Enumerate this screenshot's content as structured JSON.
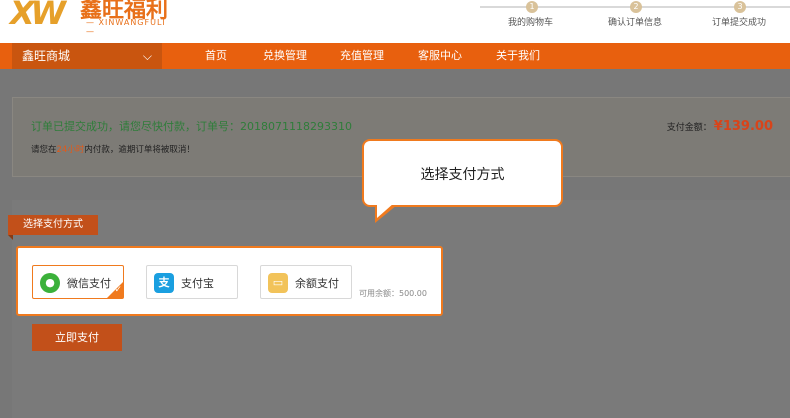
{
  "logo": {
    "mark": "XW",
    "name_cn": "鑫旺福利",
    "name_en": "— XINWANGFULI —"
  },
  "steps": [
    {
      "num": "1",
      "label": "我的购物车"
    },
    {
      "num": "2",
      "label": "确认订单信息"
    },
    {
      "num": "3",
      "label": "订单提交成功"
    }
  ],
  "nav": {
    "dropdown_label": "鑫旺商城",
    "items": [
      "首页",
      "兑换管理",
      "充值管理",
      "客服中心",
      "关于我们"
    ]
  },
  "order": {
    "status": "订单已提交成功，请您尽快付款，订单号：2018071118293310",
    "notice_prefix": "请您在",
    "notice_highlight": "24小时",
    "notice_suffix": "内付款，逾期订单将被取消！",
    "amount_label": "支付金额：",
    "amount_value": "¥139.00"
  },
  "payment": {
    "tab_label": "选择支付方式",
    "methods": [
      {
        "icon": "wechat-icon",
        "label": "微信支付",
        "color": "#3bb13a",
        "selected": true
      },
      {
        "icon": "alipay-icon",
        "label": "支付宝",
        "color": "#1a9fe0",
        "selected": false
      },
      {
        "icon": "wallet-icon",
        "label": "余额支付",
        "color": "#f2c35a",
        "selected": false
      }
    ],
    "balance_text": "可用余额：500.00",
    "pay_button": "立即支付"
  },
  "tooltip": {
    "text": "选择支付方式"
  },
  "colors": {
    "accent": "#e8600e",
    "highlight_border": "#f07a1e"
  }
}
